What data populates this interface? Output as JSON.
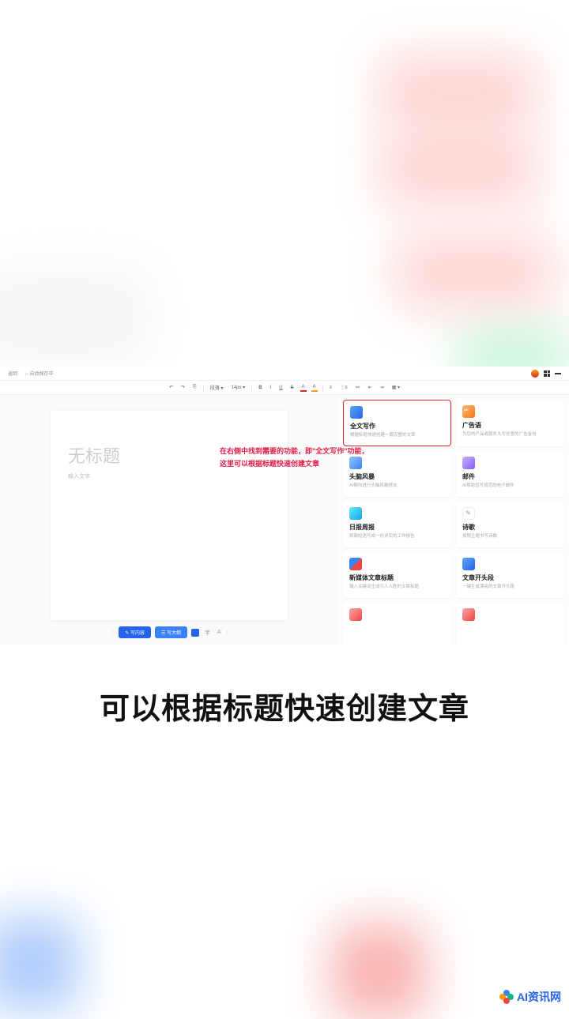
{
  "topbar": {
    "back_label": "返回",
    "save_status": "自动保存中"
  },
  "toolbar": {
    "undo": "↶",
    "redo": "↷",
    "format": "⎘",
    "para": "段落 ▾",
    "font": "14px ▾",
    "bold": "B",
    "italic": "I",
    "underline": "U",
    "strike": "S",
    "color_a": "A",
    "color_b": "A",
    "list1": "≡",
    "list2": "⋮≡",
    "list3": "≔",
    "indent1": "⇤",
    "indent2": "⇥",
    "table": "▦ ▾"
  },
  "doc": {
    "title_placeholder": "无标题",
    "body_placeholder": "输入文字"
  },
  "bottom": {
    "btn1": "✎ 写内容",
    "btn2": "☰ 写大纲",
    "m1": "字",
    "m2": "A",
    "chev": "›"
  },
  "annotation": {
    "line1": "在右侧中找到需要的功能，即\"全文写作\"功能，",
    "line2": "这里可以根据标题快速创建文章"
  },
  "cards": [
    {
      "title": "全文写作",
      "desc": "根据标题快速创建一篇完整的文章",
      "icon": "ic-blue",
      "highlight": true
    },
    {
      "title": "广告语",
      "desc": "为您的产品或服务大写创意的广告金句",
      "icon": "ic-orange"
    },
    {
      "title": "头脑风暴",
      "desc": "AI帮你进行头脑风暴想法",
      "icon": "ic-blue2"
    },
    {
      "title": "邮件",
      "desc": "AI帮助您写规范的电子邮件",
      "icon": "ic-purple"
    },
    {
      "title": "日报周报",
      "desc": "将简短语写成一份详实的工作报告",
      "icon": "ic-cyan"
    },
    {
      "title": "诗歌",
      "desc": "按照主题书写诗歌",
      "icon": "ic-white"
    },
    {
      "title": "新媒体文章标题",
      "desc": "输入关键词生成引人入胜的文章标题",
      "icon": "ic-bluered"
    },
    {
      "title": "文章开头段",
      "desc": "一键生成漂亮的文章开头段",
      "icon": "ic-blocks"
    },
    {
      "title": "",
      "desc": "",
      "icon": "ic-red"
    },
    {
      "title": "",
      "desc": "",
      "icon": "ic-red"
    }
  ],
  "caption": "可以根据标题快速创建文章",
  "watermark": "AI资讯网"
}
